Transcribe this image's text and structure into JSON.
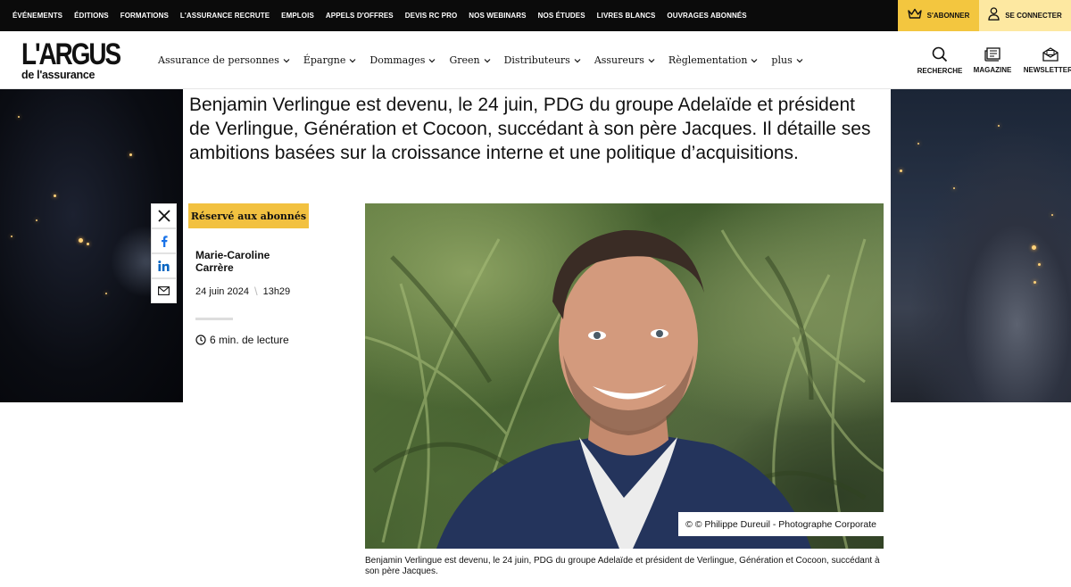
{
  "topnav": {
    "links": [
      "ÉVÉNEMENTS",
      "ÉDITIONS",
      "FORMATIONS",
      "L'ASSURANCE RECRUTE",
      "EMPLOIS",
      "APPELS D'OFFRES",
      "DEVIS RC PRO",
      "NOS WEBINARS",
      "NOS ÉTUDES",
      "LIVRES BLANCS",
      "OUVRAGES ABONNÉS"
    ],
    "subscribe_label": "S'ABONNER",
    "connect_label": "SE CONNECTER"
  },
  "logo": {
    "line1": "L'ARGUS",
    "line2": "de l'assurance"
  },
  "mainnav": {
    "items": [
      "Assurance de personnes",
      "Épargne",
      "Dommages",
      "Green",
      "Distributeurs",
      "Assureurs",
      "Règlementation",
      "plus"
    ]
  },
  "tools": {
    "search": "RECHERCHE",
    "magazine": "MAGAZINE",
    "newsletters": "NEWSLETTERS"
  },
  "article": {
    "lede": "Benjamin Verlingue est devenu, le 24 juin, PDG du groupe Adelaïde et président de Verlingue, Génération et Cocoon, succédant à son père Jacques. Il détaille ses ambitions basées sur la croissance interne et une politique d’acquisitions.",
    "badge": "Réservé aux abonnés",
    "author": "Marie-Caroline Carrère",
    "date": "24 juin 2024",
    "time": "13h29",
    "read_time": "6 min. de lecture",
    "photo_credit": "© © Philippe Dureuil - Photographe Corporate",
    "caption": "Benjamin Verlingue est devenu, le 24 juin, PDG du groupe Adelaïde et président de Verlingue, Génération et Cocoon, succédant à son père Jacques."
  },
  "share": {
    "icons": [
      "x-icon",
      "facebook-icon",
      "linkedin-icon",
      "email-icon"
    ]
  },
  "colors": {
    "accent_yellow": "#f3c63f",
    "accent_light_yellow": "#fde8a1",
    "topbar_black": "#0b0b0b"
  }
}
